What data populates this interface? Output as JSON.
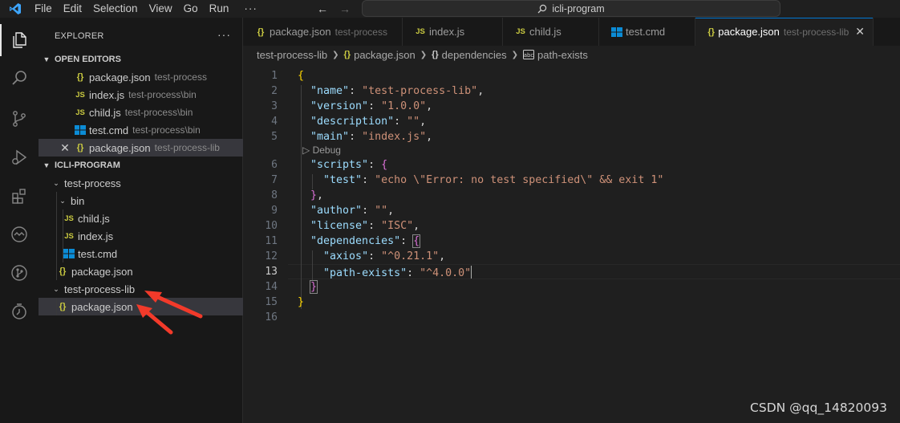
{
  "menu": [
    "File",
    "Edit",
    "Selection",
    "View",
    "Go",
    "Run",
    "···"
  ],
  "search": {
    "text": "icli-program"
  },
  "explorer": {
    "title": "EXPLORER",
    "more": "···",
    "open_editors": {
      "title": "OPEN EDITORS",
      "items": [
        {
          "icon": "json-icon",
          "name": "package.json",
          "desc": "test-process"
        },
        {
          "icon": "js-icon",
          "name": "index.js",
          "desc": "test-process\\bin"
        },
        {
          "icon": "js-icon",
          "name": "child.js",
          "desc": "test-process\\bin"
        },
        {
          "icon": "cmd-icon",
          "name": "test.cmd",
          "desc": "test-process\\bin"
        },
        {
          "icon": "json-icon",
          "name": "package.json",
          "desc": "test-process-lib",
          "close": "✕"
        }
      ]
    },
    "workspace": {
      "title": "ICLI-PROGRAM",
      "items": [
        {
          "name": "test-process"
        },
        {
          "name": "bin"
        },
        {
          "name": "child.js"
        },
        {
          "name": "index.js"
        },
        {
          "name": "test.cmd"
        },
        {
          "name": "package.json"
        },
        {
          "name": "test-process-lib"
        },
        {
          "name": "package.json"
        }
      ]
    }
  },
  "tabs": [
    {
      "name": "package.json",
      "desc": "test-process"
    },
    {
      "name": "index.js",
      "desc": ""
    },
    {
      "name": "child.js",
      "desc": ""
    },
    {
      "name": "test.cmd",
      "desc": ""
    },
    {
      "name": "package.json",
      "desc": "test-process-lib",
      "close": "✕"
    }
  ],
  "breadcrumb": [
    "test-process-lib",
    "package.json",
    "dependencies",
    "path-exists"
  ],
  "editor": {
    "line_numbers": [
      "1",
      "2",
      "3",
      "4",
      "5",
      "6",
      "7",
      "8",
      "9",
      "10",
      "11",
      "12",
      "13",
      "14",
      "15",
      "16"
    ],
    "codelens": "Debug",
    "lines": {
      "l1": "{",
      "name_k": "\"name\"",
      "name_v": "\"test-process-lib\"",
      "version_k": "\"version\"",
      "version_v": "\"1.0.0\"",
      "desc_k": "\"description\"",
      "desc_v": "\"\"",
      "main_k": "\"main\"",
      "main_v": "\"index.js\"",
      "scripts_k": "\"scripts\"",
      "test_k": "\"test\"",
      "test_v": "\"echo \\\"Error: no test specified\\\" && exit 1\"",
      "author_k": "\"author\"",
      "author_v": "\"\"",
      "license_k": "\"license\"",
      "license_v": "\"ISC\"",
      "deps_k": "\"dependencies\"",
      "axios_k": "\"axios\"",
      "axios_v": "\"^0.21.1\"",
      "pe_k": "\"path-exists\"",
      "pe_v": "\"^4.0.0\""
    }
  },
  "watermark": "CSDN @qq_14820093",
  "colors": {
    "accent": "#0078d4",
    "annotation_arrow": "#f23a2a"
  }
}
